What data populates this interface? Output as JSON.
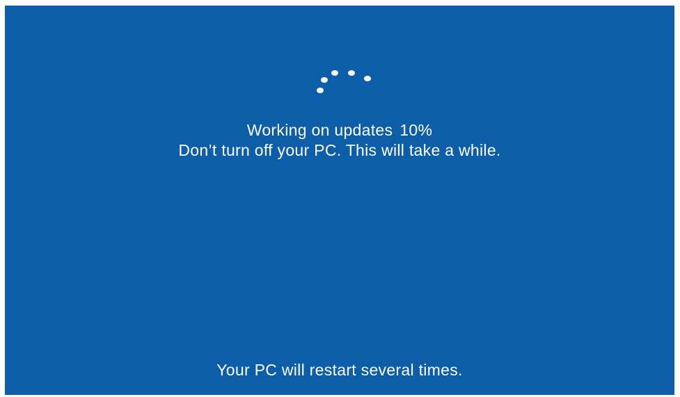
{
  "screen": {
    "background_color": "#0d5ea8",
    "text_color": "#ffffff",
    "spinner_icon": "loading-dots-icon"
  },
  "status": {
    "title": "Working on updates",
    "progress_percent": "10%",
    "warning": "Don’t turn off your PC. This will take a while."
  },
  "footer": {
    "message": "Your PC will restart several times."
  }
}
